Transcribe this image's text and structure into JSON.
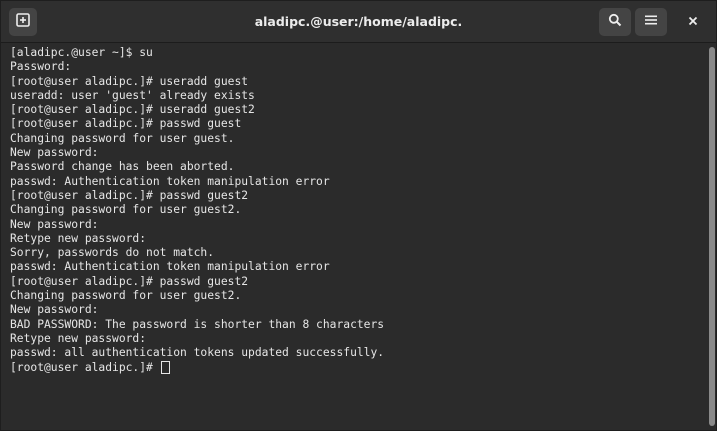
{
  "window": {
    "title": "aladipc.@user:/home/aladipc."
  },
  "titlebar": {
    "newtab_icon": "new-tab-icon",
    "search_icon": "search-icon",
    "menu_icon": "hamburger-menu-icon",
    "close_icon": "close-icon",
    "close_glyph": "×"
  },
  "terminal": {
    "lines": [
      "[aladipc.@user ~]$ su",
      "Password:",
      "[root@user aladipc.]# useradd guest",
      "useradd: user 'guest' already exists",
      "[root@user aladipc.]# useradd guest2",
      "[root@user aladipc.]# passwd guest",
      "Changing password for user guest.",
      "New password:",
      "Password change has been aborted.",
      "passwd: Authentication token manipulation error",
      "[root@user aladipc.]# passwd guest2",
      "Changing password for user guest2.",
      "New password:",
      "Retype new password:",
      "Sorry, passwords do not match.",
      "passwd: Authentication token manipulation error",
      "[root@user aladipc.]# passwd guest2",
      "Changing password for user guest2.",
      "New password:",
      "BAD PASSWORD: The password is shorter than 8 characters",
      "Retype new password:",
      "passwd: all authentication tokens updated successfully."
    ],
    "prompt": "[root@user aladipc.]# "
  },
  "colors": {
    "background": "#2b2b2b",
    "titlebar": "#2f2f2f",
    "text": "#e6e6e6",
    "button": "#444444",
    "scrollbar_thumb": "#8a8a8a"
  }
}
